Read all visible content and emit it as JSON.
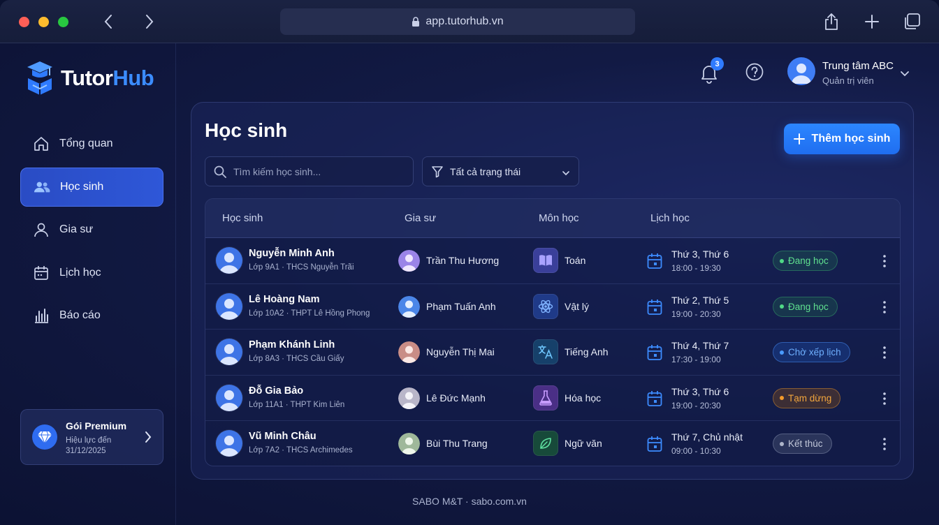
{
  "browser": {
    "url": "app.tutorhub.vn"
  },
  "brand": {
    "name_part1": "Tutor",
    "name_part2": "Hub",
    "accent": "#3b8cff"
  },
  "sidebar": {
    "items": [
      {
        "label": "Tổng quan",
        "icon": "home-icon",
        "active": false
      },
      {
        "label": "Học sinh",
        "icon": "users-icon",
        "active": true
      },
      {
        "label": "Gia sư",
        "icon": "user-icon",
        "active": false
      },
      {
        "label": "Lịch học",
        "icon": "calendar-icon",
        "active": false
      },
      {
        "label": "Báo cáo",
        "icon": "bar-chart-icon",
        "active": false
      }
    ],
    "premium": {
      "title": "Gói Premium",
      "line1": "Hiệu lực đến",
      "line2": "31/12/2025"
    }
  },
  "header": {
    "notification_count": "3",
    "user_name": "Trung tâm ABC",
    "user_role": "Quản trị viên"
  },
  "main": {
    "title": "Học sinh",
    "add_button": "Thêm học sinh",
    "search_placeholder": "Tìm kiếm học sinh...",
    "filter_label": "Tất cả trạng thái",
    "columns": [
      "Học sinh",
      "Gia sư",
      "Môn học",
      "Lịch học"
    ],
    "rows": [
      {
        "name": "Nguyễn Minh Anh",
        "sub": "Lớp 9A1 · THCS Nguyễn Trãi",
        "tutor": "Trần Thu Hương",
        "subject": "Toán",
        "subject_icon": "book-icon",
        "days": "Thứ 3, Thứ 6",
        "time": "18:00 - 19:30",
        "status": "Đang học",
        "status_type": "active"
      },
      {
        "name": "Lê Hoàng Nam",
        "sub": "Lớp 10A2 · THPT Lê Hồng Phong",
        "tutor": "Phạm Tuấn Anh",
        "subject": "Vật lý",
        "subject_icon": "atom-icon",
        "days": "Thứ 2, Thứ 5",
        "time": "19:00 - 20:30",
        "status": "Đang học",
        "status_type": "active"
      },
      {
        "name": "Phạm Khánh Linh",
        "sub": "Lớp 8A3 · THCS Cầu Giấy",
        "tutor": "Nguyễn Thị Mai",
        "subject": "Tiếng Anh",
        "subject_icon": "translate-icon",
        "days": "Thứ 4, Thứ 7",
        "time": "17:30 - 19:00",
        "status": "Chờ xếp lịch",
        "status_type": "wait"
      },
      {
        "name": "Đỗ Gia Bảo",
        "sub": "Lớp 11A1 · THPT Kim Liên",
        "tutor": "Lê Đức Mạnh",
        "subject": "Hóa học",
        "subject_icon": "flask-icon",
        "days": "Thứ 3, Thứ 6",
        "time": "19:00 - 20:30",
        "status": "Tạm dừng",
        "status_type": "pause"
      },
      {
        "name": "Vũ Minh Châu",
        "sub": "Lớp 7A2 · THCS Archimedes",
        "tutor": "Bùi Thu Trang",
        "subject": "Ngữ văn",
        "subject_icon": "leaf-icon",
        "days": "Thứ 7, Chủ nhật",
        "time": "09:00 - 10:30",
        "status": "Kết thúc",
        "status_type": "end"
      }
    ]
  },
  "footer": {
    "text": "SABO M&T · sabo.com.vn"
  }
}
